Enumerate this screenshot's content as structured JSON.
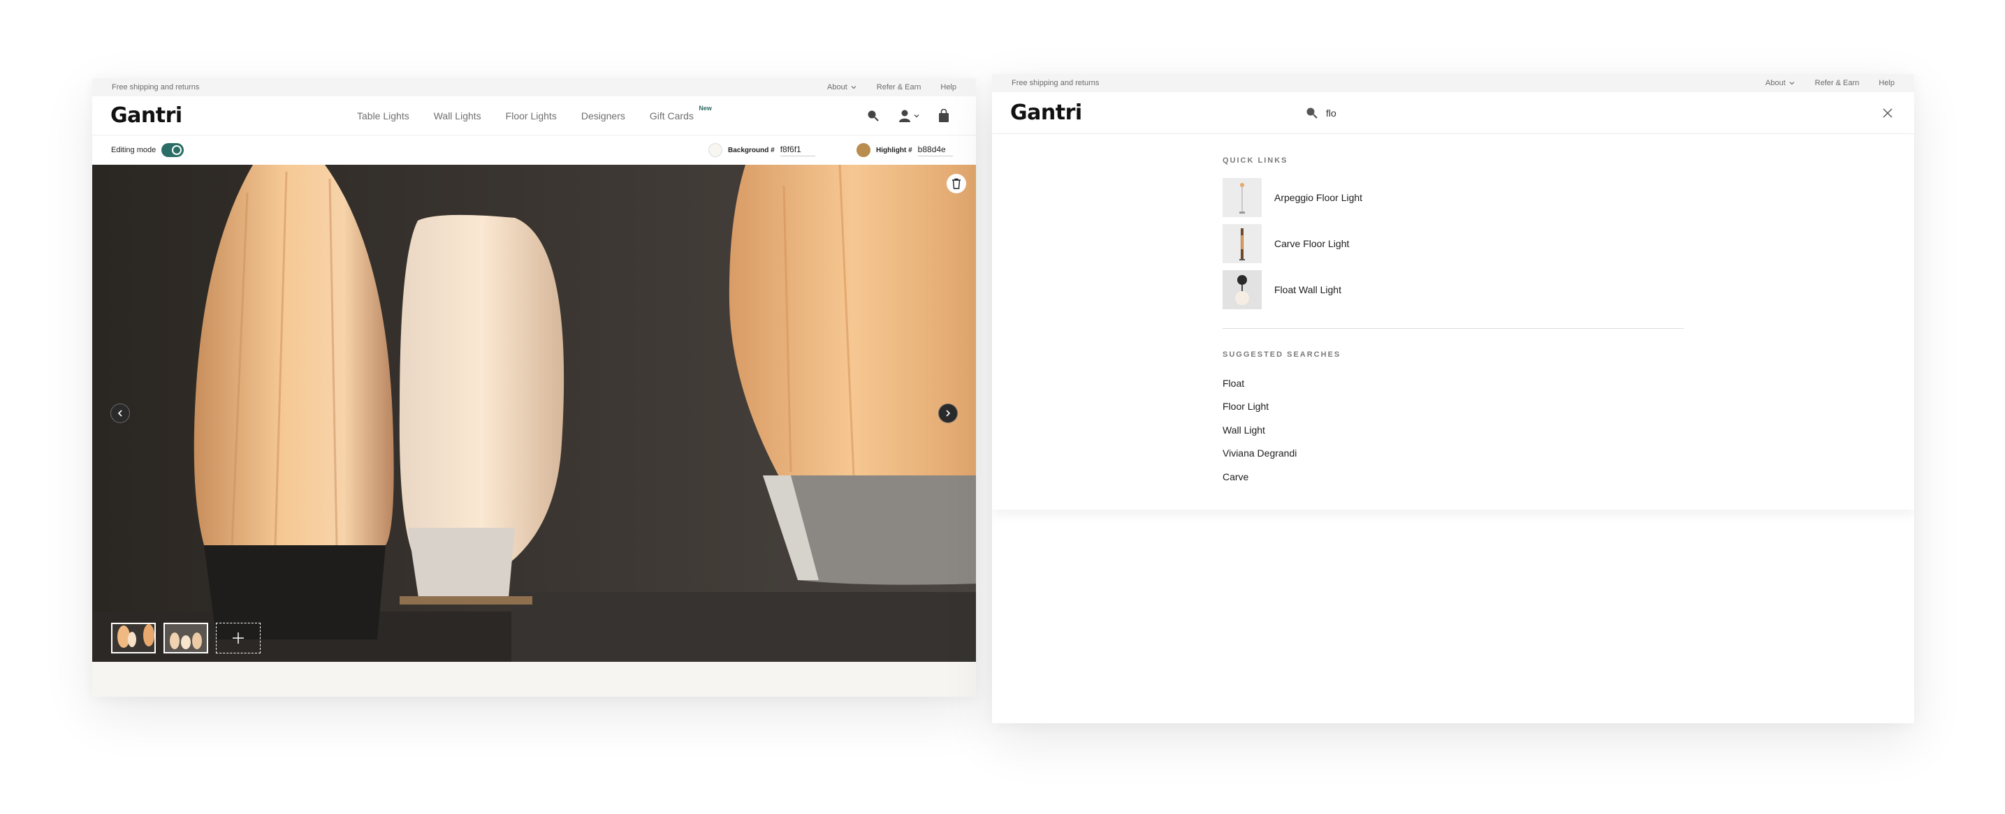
{
  "left_window": {
    "promo_text": "Free shipping and returns",
    "top_links": {
      "about": "About",
      "refer": "Refer & Earn",
      "help": "Help"
    },
    "logo": "Gantri",
    "nav": [
      {
        "label": "Table Lights"
      },
      {
        "label": "Wall Lights"
      },
      {
        "label": "Floor Lights"
      },
      {
        "label": "Designers"
      },
      {
        "label": "Gift Cards",
        "badge": "New"
      }
    ],
    "icons": [
      "search-icon",
      "account-icon",
      "cart-icon"
    ],
    "editing_mode_label": "Editing mode",
    "editing_mode_on": true,
    "background_label": "Background #",
    "background_value": "f8f6f1",
    "highlight_label": "Highlight #",
    "highlight_value": "b88d4e",
    "colors": {
      "background": "#f8f6f1",
      "highlight": "#b88d4e",
      "toggle": "#2a6d66"
    }
  },
  "right_window": {
    "promo_text": "Free shipping and returns",
    "top_links": {
      "about": "About",
      "refer": "Refer & Earn",
      "help": "Help"
    },
    "logo": "Gantri",
    "search_value": "flo",
    "quick_links_title": "QUICK LINKS",
    "quick_links": [
      {
        "label": "Arpeggio Floor Light"
      },
      {
        "label": "Carve Floor Light"
      },
      {
        "label": "Float Wall Light"
      }
    ],
    "suggested_title": "SUGGESTED SEARCHES",
    "suggested": [
      {
        "label": "Float"
      },
      {
        "label": "Floor Light"
      },
      {
        "label": "Wall Light"
      },
      {
        "label": "Viviana Degrandi"
      },
      {
        "label": "Carve"
      }
    ]
  }
}
